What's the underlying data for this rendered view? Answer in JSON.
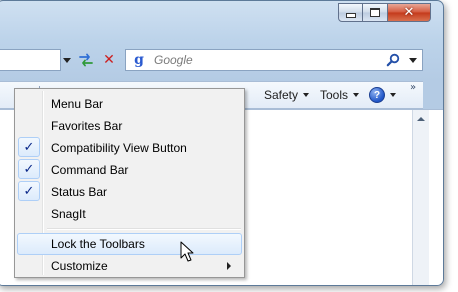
{
  "search": {
    "placeholder": "Google"
  },
  "address_bar": {
    "value": ""
  },
  "command_bar": {
    "items": [
      {
        "label": "Safety",
        "has_dropdown": true
      },
      {
        "label": "Tools",
        "has_dropdown": true
      },
      {
        "label": "",
        "icon": "help-icon",
        "has_dropdown": true
      }
    ],
    "overflow_glyph": "»"
  },
  "window_controls": {
    "close_glyph": "✕"
  },
  "context_menu": {
    "items": [
      {
        "label": "Menu Bar",
        "checked": false
      },
      {
        "label": "Favorites Bar",
        "checked": false
      },
      {
        "label": "Compatibility View Button",
        "checked": true
      },
      {
        "label": "Command Bar",
        "checked": true
      },
      {
        "label": "Status Bar",
        "checked": true
      },
      {
        "label": "SnagIt",
        "checked": false
      },
      {
        "label": "Lock the Toolbars",
        "checked": false,
        "highlighted": true
      },
      {
        "label": "Customize",
        "checked": false,
        "has_submenu": true
      }
    ],
    "check_glyph": "✓"
  },
  "colors": {
    "frame": "#bcd3ea",
    "menu_background": "#f1f1f1",
    "highlight": "#dcebfc",
    "close_button": "#c4391b",
    "check": "#0c2a8a"
  }
}
